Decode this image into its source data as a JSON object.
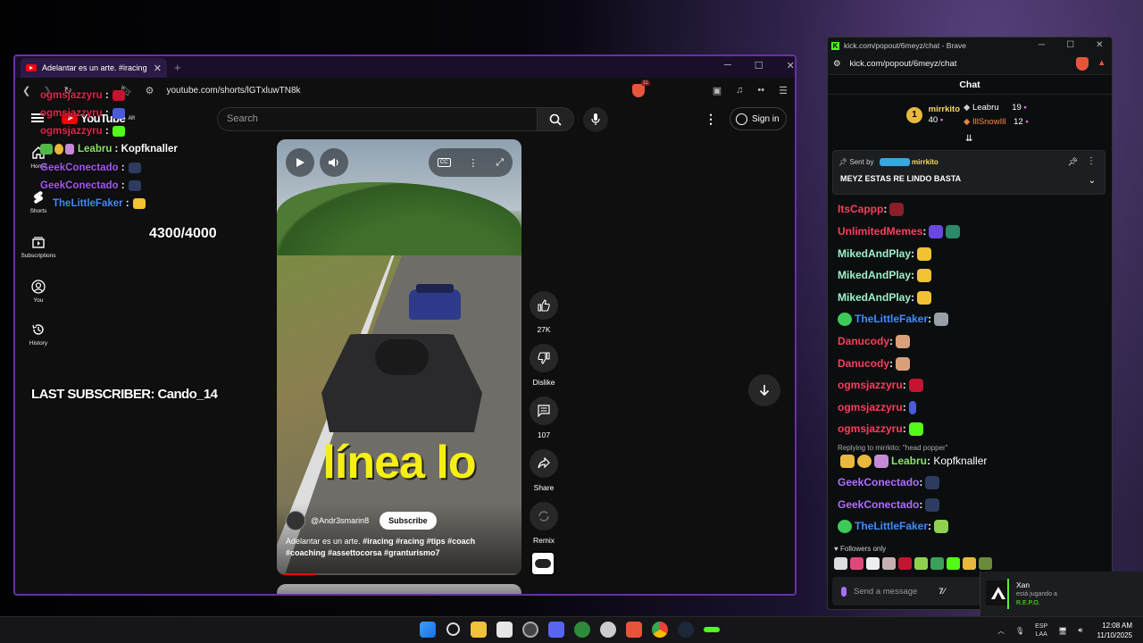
{
  "browser": {
    "tab_title": "Adelantar es un arte. #iracing #r",
    "url": "youtube.com/shorts/lGTxluwTN8k",
    "brave_badge": "11"
  },
  "youtube": {
    "logo_text": "YouTube",
    "logo_region": "AR",
    "search_placeholder": "Search",
    "signin_label": "Sign in",
    "guide": [
      {
        "label": "Home",
        "icon": "home-icon"
      },
      {
        "label": "Shorts",
        "icon": "shorts-icon"
      },
      {
        "label": "Subscriptions",
        "icon": "subscriptions-icon"
      },
      {
        "label": "You",
        "icon": "you-icon"
      },
      {
        "label": "History",
        "icon": "history-icon"
      }
    ],
    "video": {
      "caption": "línea lo",
      "channel": "@Andr3smarin8",
      "subscribe_label": "Subscribe",
      "description_plain": "Adelantar es un arte. ",
      "description_tags": "#iracing #racing #tips #coach #coaching #assettocorsa #granturismo7",
      "progress": 0.16
    },
    "actions": {
      "likes": "27K",
      "dislike_label": "Dislike",
      "comments": "107",
      "share_label": "Share",
      "remix_label": "Remix"
    }
  },
  "overlay": {
    "chat_lines": [
      {
        "user": "ogmsjazzyru",
        "color": "#e0264a",
        "sep": " :"
      },
      {
        "user": "ogmsjazzyru",
        "color": "#e0264a",
        "sep": " :"
      },
      {
        "user": "ogmsjazzyru",
        "color": "#e0264a",
        "sep": " :"
      },
      {
        "user": "Leabru",
        "color": "#89e36a",
        "sep": " : Kopfknaller"
      },
      {
        "user": "GeekConectado",
        "color": "#a855f7",
        "sep": " :"
      },
      {
        "user": "GeekConectado",
        "color": "#a855f7",
        "sep": " :"
      },
      {
        "user": "TheLittleFaker",
        "color": "#3f8cff",
        "sep": " :"
      }
    ],
    "goal": "4300/4000",
    "last_subscriber": "LAST SUBSCRIBER: Cando_14"
  },
  "kick": {
    "window_title": "kick.com/popout/6meyz/chat - Brave",
    "url": "kick.com/popout/6meyz/chat",
    "header": "Chat",
    "leaderboard": [
      {
        "rank": "1",
        "name": "mirrkito",
        "value": "40"
      },
      {
        "rank": "",
        "name": "Leabru",
        "value": "19"
      },
      {
        "rank": "",
        "name": "IllSnowIll",
        "value": "12"
      }
    ],
    "pinned": {
      "sent_by_label": "Sent by",
      "sender": "mirrkito",
      "message": "MEYZ ESTAS RE LINDO BASTA"
    },
    "messages": [
      {
        "user": "ItsCappp",
        "color": "#ff3b5c"
      },
      {
        "user": "UnlimitedMemes",
        "color": "#ff3b5c"
      },
      {
        "user": "MikedAndPlay",
        "color": "#9cf2c8"
      },
      {
        "user": "MikedAndPlay",
        "color": "#9cf2c8"
      },
      {
        "user": "MikedAndPlay",
        "color": "#9cf2c8"
      },
      {
        "user": "TheLittleFaker",
        "color": "#3f8cff"
      },
      {
        "user": "Danucody",
        "color": "#ff3b5c"
      },
      {
        "user": "Danucody",
        "color": "#ff3b5c"
      },
      {
        "user": "ogmsjazzyru",
        "color": "#ff3b5c"
      },
      {
        "user": "ogmsjazzyru",
        "color": "#ff3b5c"
      },
      {
        "user": "ogmsjazzyru",
        "color": "#ff3b5c"
      }
    ],
    "reply_note": "Replying to mirrkito: \"head popper\"",
    "reply_message": {
      "user": "Leabru",
      "text": " Kopfknaller"
    },
    "messages_after": [
      {
        "user": "GeekConectado",
        "color": "#b26bff"
      },
      {
        "user": "GeekConectado",
        "color": "#b26bff"
      },
      {
        "user": "TheLittleFaker",
        "color": "#3f8cff"
      }
    ],
    "followers_only": "Followers only",
    "input_placeholder": "Send a message"
  },
  "notification": {
    "name": "Xan",
    "status": "está jugando a",
    "game": "R.E.P.O."
  },
  "taskbar": {
    "lang_top": "ESP",
    "lang_bottom": "LAA",
    "time": "12:08 AM",
    "date": "11/10/2025"
  }
}
